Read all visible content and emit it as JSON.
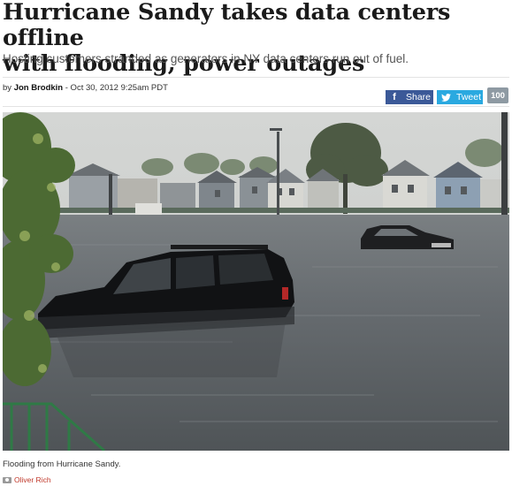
{
  "article": {
    "headline_line1": "Hurricane Sandy takes data centers offline",
    "headline_line2": "with flooding, power outages",
    "subhead": "Hosting customers stranded as generators in NY data centers run out of fuel.",
    "byline_prefix": "by ",
    "author": "Jon Brodkin",
    "date": " - Oct 30, 2012 9:25am PDT"
  },
  "social": {
    "share_label": "Share",
    "tweet_label": "Tweet",
    "count": "100",
    "facebook_icon": "facebook-icon",
    "twitter_icon": "twitter-icon"
  },
  "photo": {
    "caption": "Flooding from Hurricane Sandy.",
    "credit": "Oliver Rich",
    "credit_icon": "camera-icon"
  }
}
